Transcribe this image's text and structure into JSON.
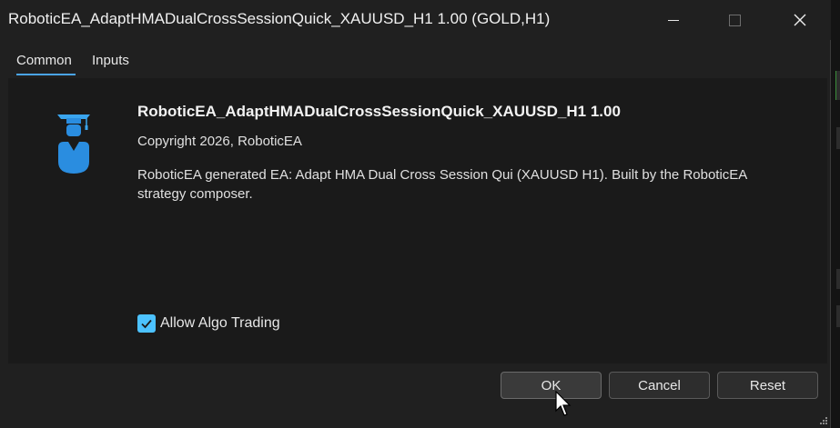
{
  "window": {
    "title": "RoboticEA_AdaptHMADualCrossSessionQuick_XAUUSD_H1 1.00 (GOLD,H1)",
    "controls": [
      "minimize-icon",
      "maximize-icon",
      "close-icon"
    ]
  },
  "tabs": [
    {
      "label": "Common",
      "active": true
    },
    {
      "label": "Inputs",
      "active": false
    }
  ],
  "common": {
    "icon": "graduate-user-icon",
    "ea_name": "RoboticEA_AdaptHMADualCrossSessionQuick_XAUUSD_H1 1.00",
    "copyright": "Copyright 2026, RoboticEA",
    "description": "RoboticEA generated EA: Adapt HMA Dual Cross Session Qui (XAUUSD H1). Built by the RoboticEA strategy composer.",
    "allow_algo_trading": {
      "label": "Allow Algo Trading",
      "checked": true
    }
  },
  "buttons": {
    "ok": "OK",
    "cancel": "Cancel",
    "reset": "Reset"
  },
  "colors": {
    "accent": "#4cc2ff",
    "tab_underline": "#4aa4ea",
    "icon_blue": "#2a8de0"
  }
}
